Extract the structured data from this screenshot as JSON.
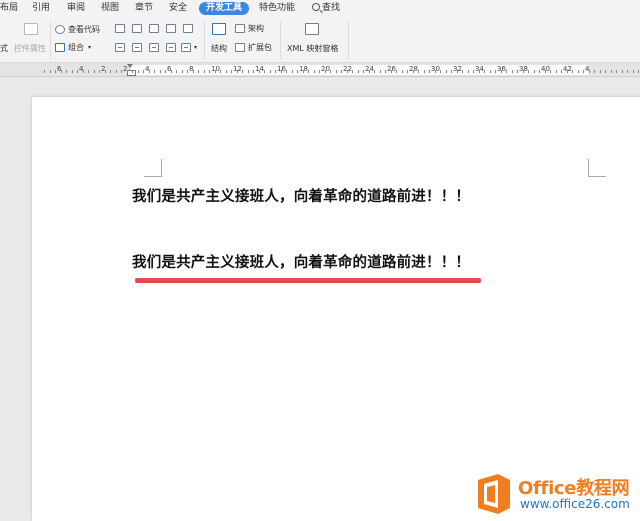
{
  "menu": {
    "tabs": [
      "布局",
      "引用",
      "审阅",
      "视图",
      "章节",
      "安全",
      "开发工具",
      "特色功能"
    ],
    "active_tab": "开发工具",
    "search_label": "查找"
  },
  "ribbon": {
    "left_partial_label": "式",
    "control_properties": "控件属性",
    "view_code": "查看代码",
    "combine": "组合",
    "structure": "结构",
    "architecture": "架构",
    "expansion_pack": "扩展包",
    "xml_mapping_pane": "XML 映射窗格"
  },
  "ruler": {
    "numbers": [
      "6",
      "4",
      "2",
      "2",
      "4",
      "6",
      "8",
      "10",
      "12",
      "14",
      "16",
      "18",
      "20",
      "22",
      "24",
      "26",
      "28",
      "30",
      "32",
      "34",
      "36",
      "38",
      "40",
      "42",
      "4"
    ]
  },
  "document": {
    "line1": "我们是共产主义接班人，向着革命的道路前进！！！",
    "line2": "我们是共产主义接班人，向着革命的道路前进！！！"
  },
  "watermark": {
    "brand_title": "Office教程网",
    "brand_url": "www.office26.com"
  },
  "colors": {
    "accent_tab": "#3b86e8",
    "underline_mark": "#e84a4a",
    "logo_orange": "#f07d1f",
    "logo_blue": "#1f75c8"
  }
}
